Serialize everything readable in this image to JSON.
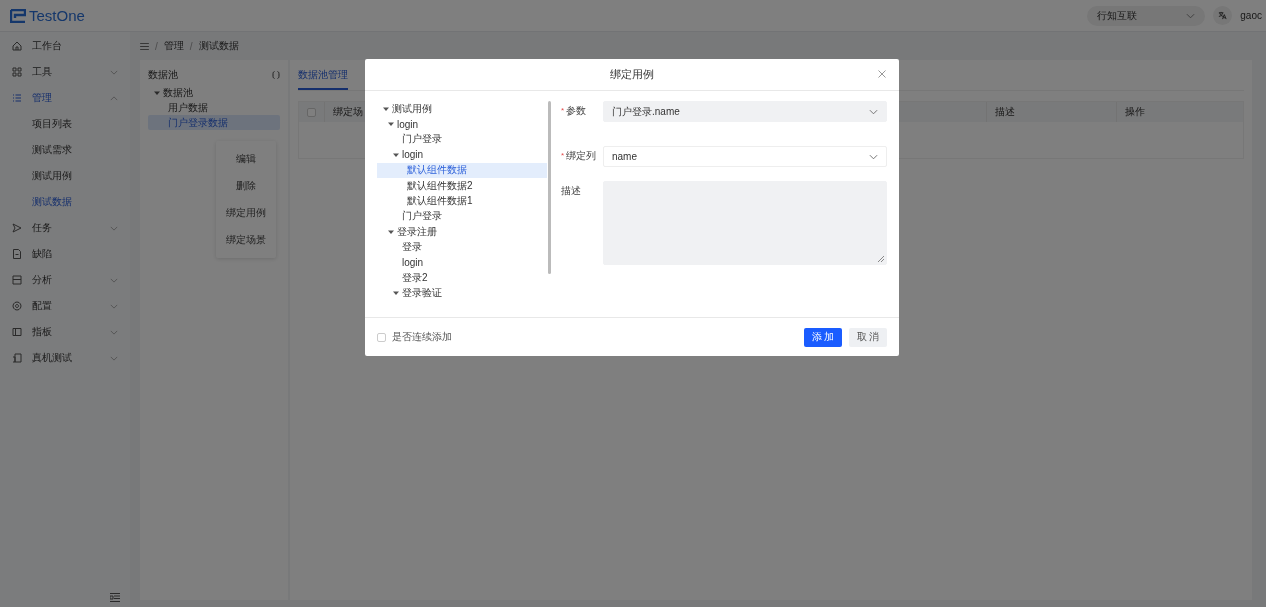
{
  "header": {
    "logo": "TestOne",
    "org_select": "行知互联",
    "user": "gaoc"
  },
  "sidebar": {
    "items": [
      {
        "label": "工作台",
        "selected": false
      },
      {
        "label": "工具",
        "selected": false,
        "expanded": false
      },
      {
        "label": "管理",
        "selected": true,
        "expanded": true,
        "children": [
          {
            "label": "项目列表",
            "selected": false
          },
          {
            "label": "测试需求",
            "selected": false
          },
          {
            "label": "测试用例",
            "selected": false
          },
          {
            "label": "测试数据",
            "selected": true
          }
        ]
      },
      {
        "label": "任务",
        "selected": false,
        "expanded": false
      },
      {
        "label": "缺陷",
        "selected": false
      },
      {
        "label": "分析",
        "selected": false,
        "expanded": false
      },
      {
        "label": "配置",
        "selected": false,
        "expanded": false
      },
      {
        "label": "指板",
        "selected": false,
        "expanded": false
      },
      {
        "label": "真机测试",
        "selected": false,
        "expanded": false
      }
    ]
  },
  "breadcrumb": {
    "separator": "/",
    "items": [
      "管理",
      "测试数据"
    ]
  },
  "data_pool": {
    "title": "数据池",
    "tree": [
      {
        "label": "数据池",
        "selected": false,
        "expanded": true,
        "children": [
          {
            "label": "用户数据",
            "selected": false
          },
          {
            "label": "门户登录数据",
            "selected": true
          }
        ]
      }
    ]
  },
  "context_menu": [
    "编辑",
    "删除",
    "绑定用例",
    "绑定场景"
  ],
  "tabs": [
    {
      "label": "数据池管理",
      "selected": true
    }
  ],
  "table": {
    "select_all_checked": false,
    "columns": [
      "绑定场",
      "描述",
      "操作"
    ]
  },
  "dialog": {
    "title": "绑定用例",
    "tree": [
      {
        "label": "测试用例",
        "selected": false,
        "expanded": true,
        "children": [
          {
            "label": "login",
            "selected": false,
            "expanded": true,
            "children": [
              {
                "label": "门户登录",
                "selected": false
              },
              {
                "label": "login",
                "selected": false,
                "expanded": true,
                "children": [
                  {
                    "label": "默认组件数据",
                    "selected": true
                  },
                  {
                    "label": "默认组件数据2",
                    "selected": false
                  },
                  {
                    "label": "默认组件数据1",
                    "selected": false
                  }
                ]
              },
              {
                "label": "门户登录",
                "selected": false
              }
            ]
          },
          {
            "label": "登录注册",
            "selected": false,
            "expanded": true,
            "children": [
              {
                "label": "登录",
                "selected": false
              },
              {
                "label": "login",
                "selected": false
              },
              {
                "label": "登录2",
                "selected": false
              },
              {
                "label": "登录验证",
                "selected": false,
                "expanded": true
              }
            ]
          }
        ]
      }
    ],
    "fields": [
      {
        "kind": "select",
        "label": "参数",
        "required_mark": "*",
        "value": "门户登录.name",
        "disabled": true
      },
      {
        "kind": "select",
        "label": "绑定列",
        "required_mark": "*",
        "value": "name",
        "disabled": false
      },
      {
        "kind": "textarea",
        "label": "描述",
        "disabled": true
      }
    ],
    "continuous_add": {
      "label": "是否连续添加",
      "checked": false
    },
    "buttons": [
      {
        "label": "添 加",
        "kind": "primary"
      },
      {
        "label": "取 消",
        "kind": "default"
      }
    ]
  }
}
